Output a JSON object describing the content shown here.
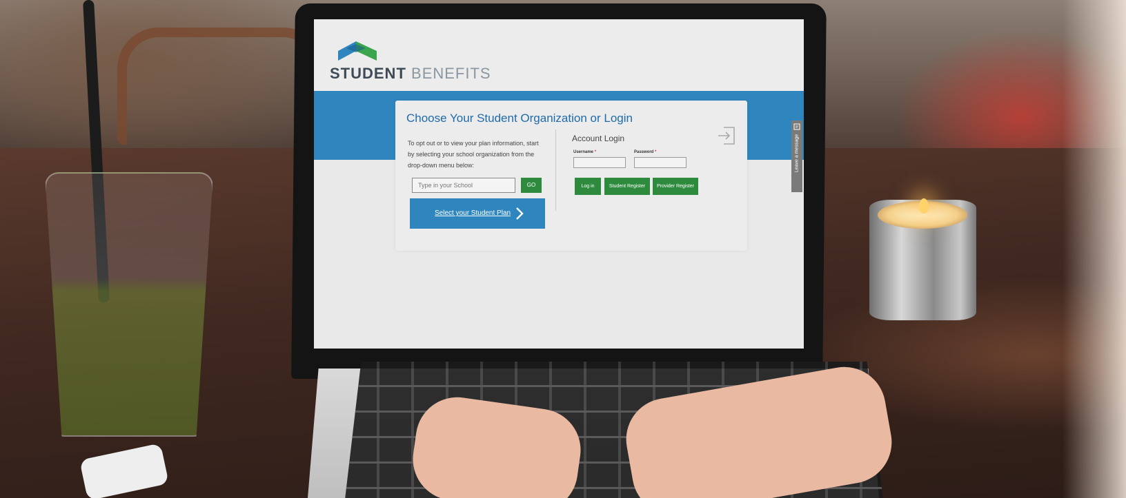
{
  "site": {
    "brand_bold": "STUDENT",
    "brand_light": "BENEFITS",
    "logo_icon": "house-roof-logo-icon",
    "colors": {
      "blue": "#2f86bf",
      "green": "#2e8b3e",
      "title": "#1f6aa8"
    }
  },
  "card": {
    "title": "Choose Your Student Organization or Login",
    "intro": "To opt out or to view your plan information, start by selecting your school organization from the drop-down menu below:",
    "school_placeholder": "Type in your School",
    "go_label": "GO",
    "plan_link": "Select your Student Plan"
  },
  "login": {
    "title": "Account Login",
    "username_label": "Username",
    "password_label": "Password",
    "required_mark": "*",
    "login_button": "Log in",
    "student_register": "Student Register",
    "provider_register": "Provider Register"
  },
  "feedback": {
    "label": "Leave a message",
    "icon": "message-icon"
  }
}
